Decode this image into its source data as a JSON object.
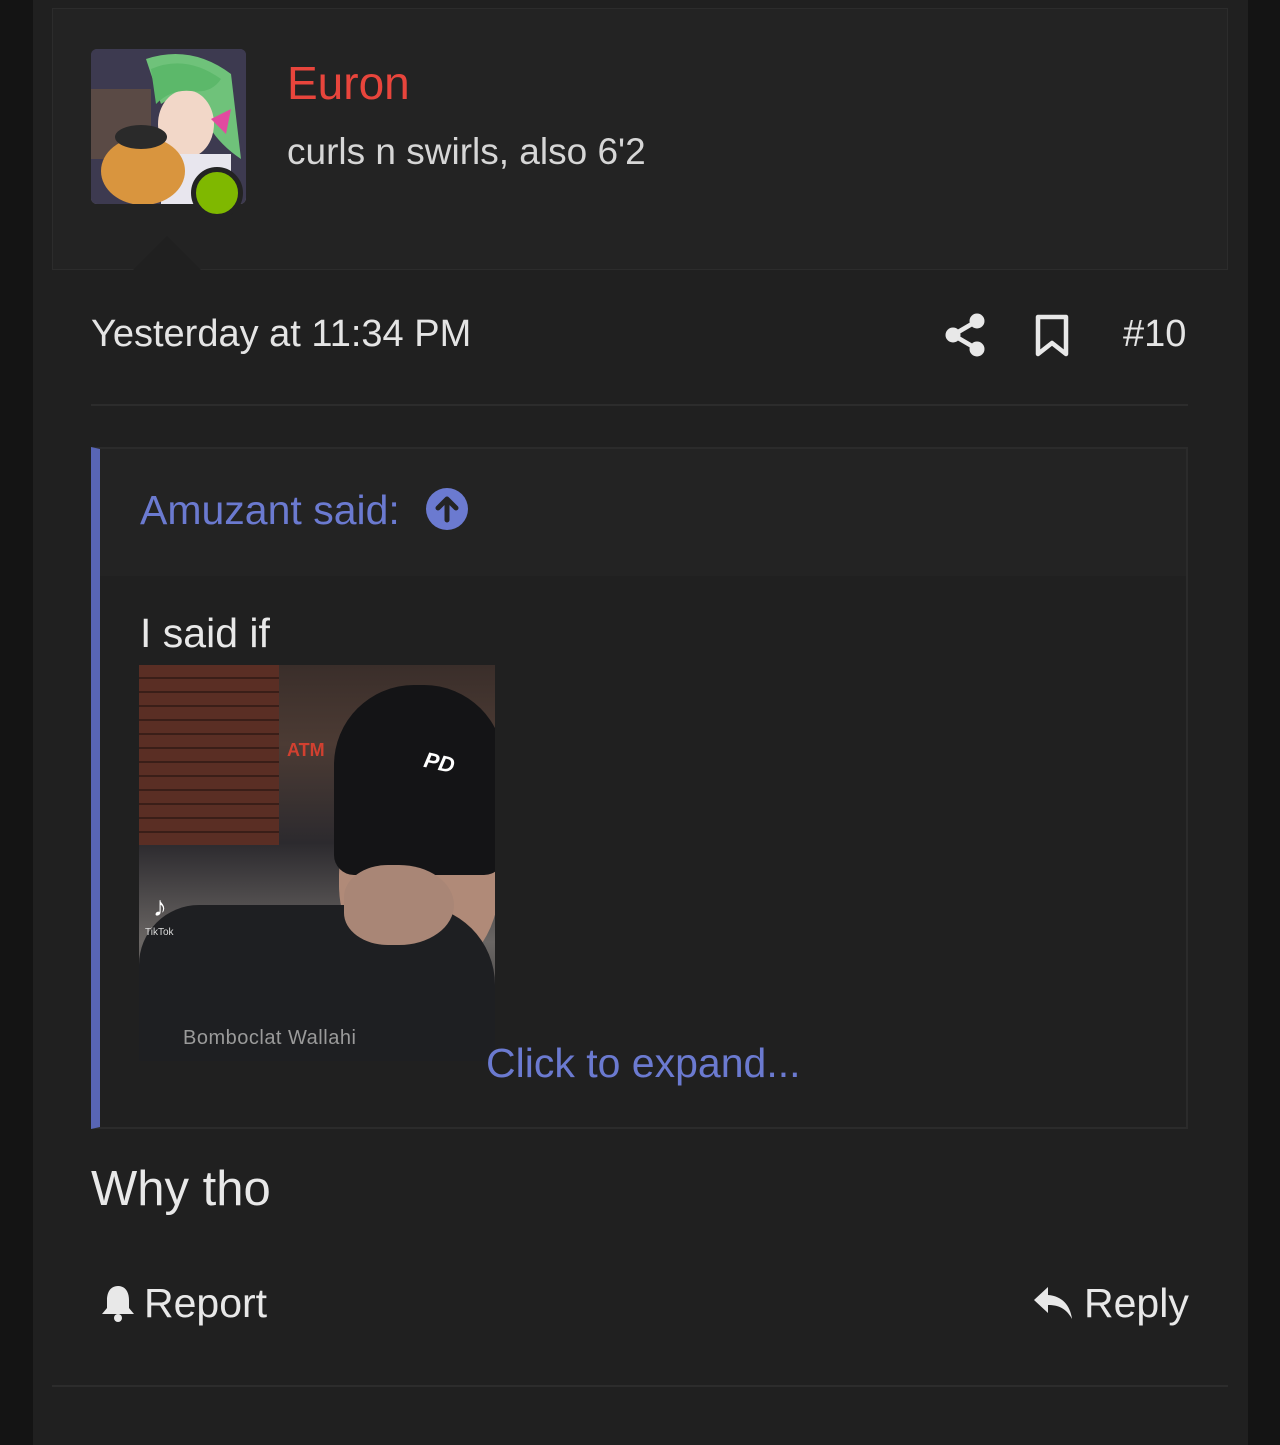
{
  "post": {
    "author": {
      "username": "Euron",
      "user_title": "curls n swirls, also 6'2",
      "online": true,
      "username_color": "#e8453c"
    },
    "timestamp": "Yesterday at 11:34 PM",
    "post_number": "#10",
    "actions": {
      "share_icon": "share-icon",
      "bookmark_icon": "bookmark-icon"
    },
    "quote": {
      "author_label": "Amuzant said:",
      "jump_icon": "arrow-up-circle-icon",
      "text": "I said if",
      "gif_caption": "Bomboclat Wallahi",
      "gif_watermark": "TikTok",
      "expand_link": "Click to expand..."
    },
    "message": "Why tho",
    "footer": {
      "report_label": "Report",
      "reply_label": "Reply"
    }
  },
  "colors": {
    "accent": "#6b7ad0",
    "quote_bar": "#5865b5",
    "online": "#7fb800"
  }
}
